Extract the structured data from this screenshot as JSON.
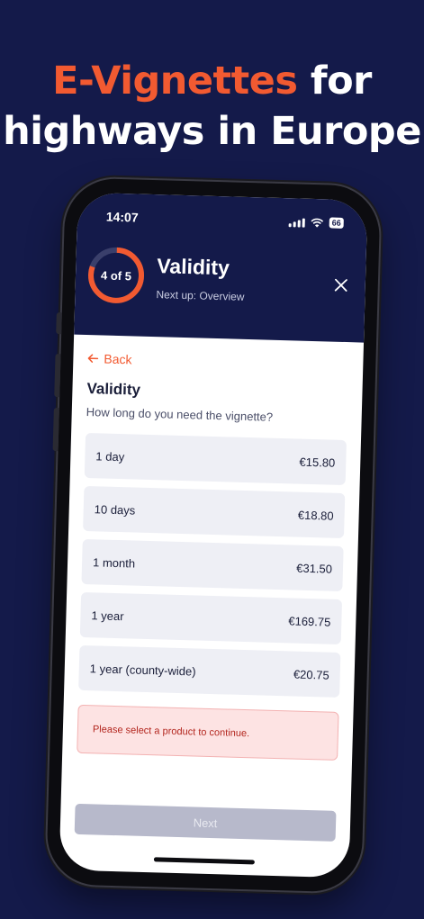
{
  "headline": {
    "accent": "E-Vignettes",
    "rest_line1": " for",
    "line2": "highways in Europe"
  },
  "status_bar": {
    "time": "14:07",
    "battery": "66"
  },
  "header": {
    "progress_label": "4 of 5",
    "progress_fraction": 0.8,
    "title": "Validity",
    "next_up": "Next up: Overview"
  },
  "content": {
    "back_label": "Back",
    "section_title": "Validity",
    "section_subtitle": "How long do you need the vignette?",
    "options": [
      {
        "label": "1 day",
        "price": "€15.80"
      },
      {
        "label": "10 days",
        "price": "€18.80"
      },
      {
        "label": "1 month",
        "price": "€31.50"
      },
      {
        "label": "1 year",
        "price": "€169.75"
      },
      {
        "label": "1 year (county-wide)",
        "price": "€20.75"
      }
    ],
    "error_message": "Please select a product to continue.",
    "next_label": "Next"
  },
  "colors": {
    "navy": "#141a4a",
    "accent": "#f25a31",
    "error_bg": "#fde3e3",
    "error_text": "#b3261e",
    "disabled_button": "#b7b9cb"
  }
}
